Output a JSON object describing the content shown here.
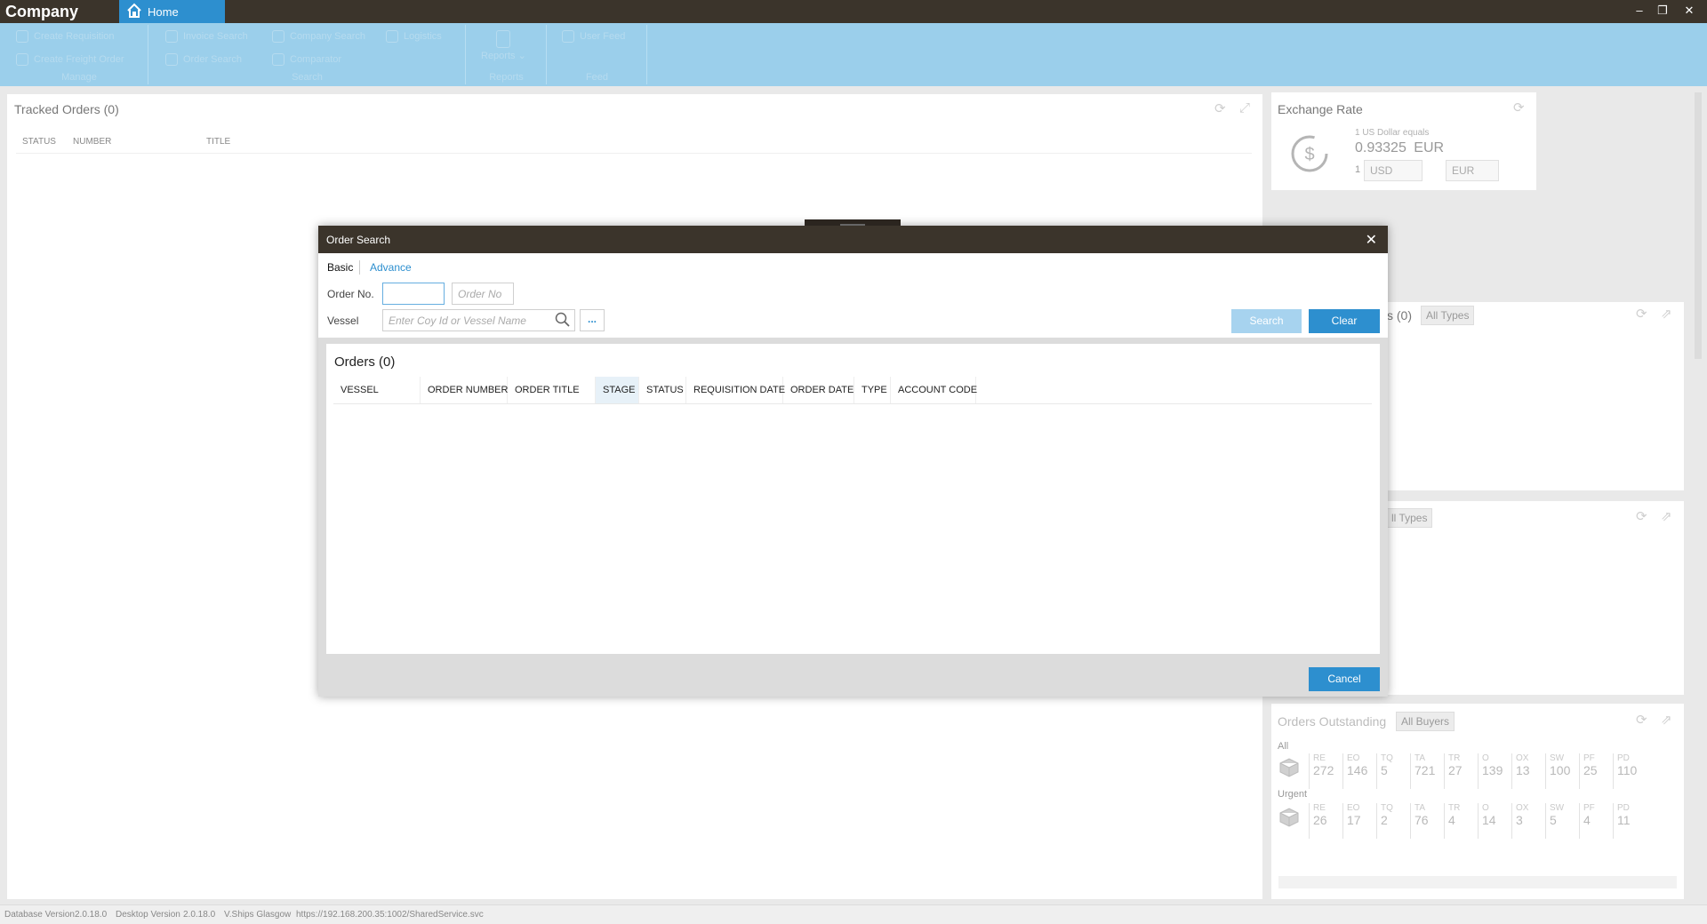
{
  "app": {
    "title": "Company",
    "home_tab": "Home"
  },
  "window_controls": {
    "minimize": "–",
    "restore": "❐",
    "close": "✕"
  },
  "ribbon": {
    "groups": [
      {
        "label": "Manage",
        "buttons": [
          "Create Requisition",
          "Create Freight Order"
        ]
      },
      {
        "label": "Search",
        "buttons": [
          "Invoice Search",
          "Order Search",
          "Company Search",
          "Comparator",
          "Logistics"
        ]
      },
      {
        "label": "Reports",
        "buttons": [
          "Reports ⌄"
        ]
      },
      {
        "label": "Feed",
        "buttons": [
          "User Feed"
        ]
      }
    ]
  },
  "tracked_orders": {
    "title": "Tracked Orders (0)",
    "columns": [
      "STATUS",
      "NUMBER",
      "TITLE"
    ]
  },
  "exchange_rate": {
    "title": "Exchange Rate",
    "equals_text": "1 US Dollar equals",
    "rate": "0.93325",
    "currency": "EUR",
    "amount": "1",
    "from_currency": "USD",
    "to_currency": "EUR"
  },
  "side_panels": {
    "panel1_title_fragment": "s (0)",
    "panel1_filter": "All Types",
    "panel2_filter_fragment": "ll Types"
  },
  "orders_outstanding": {
    "title": "Orders Outstanding",
    "filter": "All Buyers",
    "rows": [
      {
        "label": "All",
        "cells": [
          {
            "code": "RE",
            "value": "272"
          },
          {
            "code": "EO",
            "value": "146"
          },
          {
            "code": "TQ",
            "value": "5"
          },
          {
            "code": "TA",
            "value": "721"
          },
          {
            "code": "TR",
            "value": "27"
          },
          {
            "code": "O",
            "value": "139"
          },
          {
            "code": "OX",
            "value": "13"
          },
          {
            "code": "SW",
            "value": "100"
          },
          {
            "code": "PF",
            "value": "25"
          },
          {
            "code": "PD",
            "value": "110"
          }
        ]
      },
      {
        "label": "Urgent",
        "cells": [
          {
            "code": "RE",
            "value": "26"
          },
          {
            "code": "EO",
            "value": "17"
          },
          {
            "code": "TQ",
            "value": "2"
          },
          {
            "code": "TA",
            "value": "76"
          },
          {
            "code": "TR",
            "value": "4"
          },
          {
            "code": "O",
            "value": "14"
          },
          {
            "code": "OX",
            "value": "3"
          },
          {
            "code": "SW",
            "value": "5"
          },
          {
            "code": "PF",
            "value": "4"
          },
          {
            "code": "PD",
            "value": "11"
          }
        ]
      }
    ]
  },
  "status_bar": {
    "db_label": "Database Version",
    "db_version": "2.0.18.0",
    "desktop_label": "Desktop Version",
    "desktop_version": "2.0.18.0",
    "location": "V.Ships Glasgow",
    "url": "https://192.168.200.35:1002/SharedService.svc"
  },
  "order_search_dialog": {
    "title": "Order Search",
    "close": "✕",
    "tabs": {
      "basic": "Basic",
      "advance": "Advance"
    },
    "order_no_label": "Order No.",
    "order_no_prefix_value": "",
    "order_no_placeholder": "Order No",
    "vessel_label": "Vessel",
    "vessel_placeholder": "Enter Coy Id or Vessel Name",
    "ellipsis": "...",
    "search_button": "Search",
    "clear_button": "Clear",
    "results_title": "Orders (0)",
    "columns": [
      "VESSEL",
      "ORDER NUMBER",
      "ORDER TITLE",
      "STAGE",
      "STATUS",
      "REQUISITION DATE",
      "ORDER DATE",
      "TYPE",
      "ACCOUNT CODE"
    ],
    "cancel_button": "Cancel"
  }
}
